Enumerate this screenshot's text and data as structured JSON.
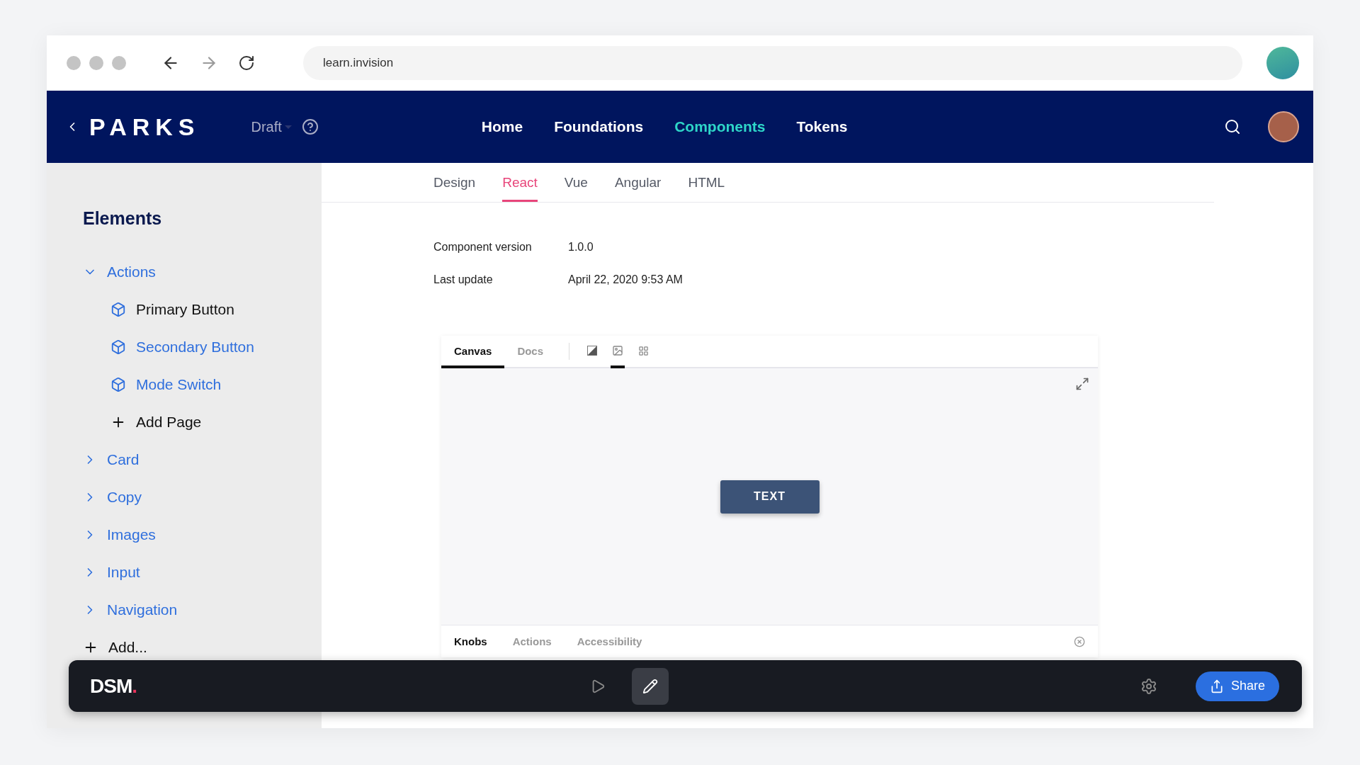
{
  "browser": {
    "url": "learn.invision"
  },
  "nav": {
    "logo": "PARKS",
    "status": "Draft",
    "links": [
      {
        "label": "Home",
        "selected": false
      },
      {
        "label": "Foundations",
        "selected": false
      },
      {
        "label": "Components",
        "selected": true
      },
      {
        "label": "Tokens",
        "selected": false
      }
    ]
  },
  "sidebar": {
    "title": "Elements",
    "items": [
      {
        "label": "Actions",
        "kind": "group",
        "expanded": true,
        "children": [
          {
            "label": "Primary Button",
            "kind": "page",
            "selected": true
          },
          {
            "label": "Secondary Button",
            "kind": "page",
            "selected": false
          },
          {
            "label": "Mode Switch",
            "kind": "page",
            "selected": false
          },
          {
            "label": "Add Page",
            "kind": "add"
          }
        ]
      },
      {
        "label": "Card",
        "kind": "group",
        "expanded": false
      },
      {
        "label": "Copy",
        "kind": "group",
        "expanded": false
      },
      {
        "label": "Images",
        "kind": "group",
        "expanded": false
      },
      {
        "label": "Input",
        "kind": "group",
        "expanded": false
      },
      {
        "label": "Navigation",
        "kind": "group",
        "expanded": false
      },
      {
        "label": "Add...",
        "kind": "add"
      }
    ]
  },
  "tabs": [
    {
      "label": "Design",
      "selected": false
    },
    {
      "label": "React",
      "selected": true
    },
    {
      "label": "Vue",
      "selected": false
    },
    {
      "label": "Angular",
      "selected": false
    },
    {
      "label": "HTML",
      "selected": false
    }
  ],
  "meta": [
    {
      "label": "Component version",
      "value": "1.0.0"
    },
    {
      "label": "Last update",
      "value": "April 22, 2020 9:53 AM"
    }
  ],
  "canvas": {
    "tabs": [
      {
        "label": "Canvas",
        "selected": true
      },
      {
        "label": "Docs",
        "selected": false
      }
    ],
    "tools": [
      {
        "kind": "contrast",
        "selected": false
      },
      {
        "kind": "image",
        "selected": true
      },
      {
        "kind": "grid",
        "selected": false
      }
    ],
    "preview_button": "TEXT",
    "addon_tabs": [
      {
        "label": "Knobs",
        "selected": true
      },
      {
        "label": "Actions",
        "selected": false
      },
      {
        "label": "Accessibility",
        "selected": false
      }
    ]
  },
  "dsm": {
    "logo": "DSM.",
    "modes": [
      {
        "kind": "play",
        "selected": false
      },
      {
        "kind": "edit",
        "selected": true
      }
    ],
    "share": "Share"
  }
}
